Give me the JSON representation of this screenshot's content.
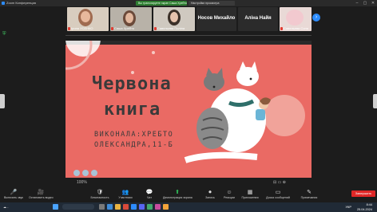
{
  "window": {
    "title": "Zoom Конференция",
    "banner_share": "Вы транслируете экран Саша Хребто",
    "banner_view": "Настройки просмотра"
  },
  "participants": [
    {
      "name": "Ірина УСЕНКО",
      "kind": "video",
      "bg": "#d8cdbf"
    },
    {
      "name": "Саша Хребто",
      "kind": "video",
      "bg": "#b8b2a8"
    },
    {
      "name": "Савельева Поліна",
      "kind": "video",
      "bg": "#cfc9c0"
    },
    {
      "name": "Носов Михайло",
      "kind": "plain"
    },
    {
      "name": "Аліна Найя",
      "kind": "plain"
    },
    {
      "name": "Савельева Соня",
      "kind": "video",
      "bg": "#e9d9d6"
    }
  ],
  "slide": {
    "title_line1": "Червона",
    "title_line2": "книга",
    "author_line1": "ВИКОНАЛА:ХРЕБТО",
    "author_line2": "ОЛЕКСАНДРА,11-Б"
  },
  "share_footer": {
    "left_control": "100%",
    "right_controls": "⊟ ▭ ⊕"
  },
  "toolbar": {
    "items": [
      {
        "label": "Включить звук",
        "icon": "🎤"
      },
      {
        "label": "Остановить видео",
        "icon": "🎥"
      },
      {
        "label": "Безопасность",
        "icon": "🛡"
      },
      {
        "label": "Участники",
        "icon": "👥"
      },
      {
        "label": "Чат",
        "icon": "💬"
      },
      {
        "label": "Демонстрация экрана",
        "icon": "⬆"
      },
      {
        "label": "Запись",
        "icon": "⏺"
      },
      {
        "label": "Реакции",
        "icon": "☺"
      },
      {
        "label": "Приложения",
        "icon": "▦"
      },
      {
        "label": "Доска сообщений",
        "icon": "▭"
      },
      {
        "label": "Примечания",
        "icon": "✎"
      }
    ],
    "end_label": "Завершить"
  },
  "taskbar": {
    "weather": "☁ ‑",
    "language": "УКР",
    "time": "8:44",
    "date": "25.04.2024"
  }
}
